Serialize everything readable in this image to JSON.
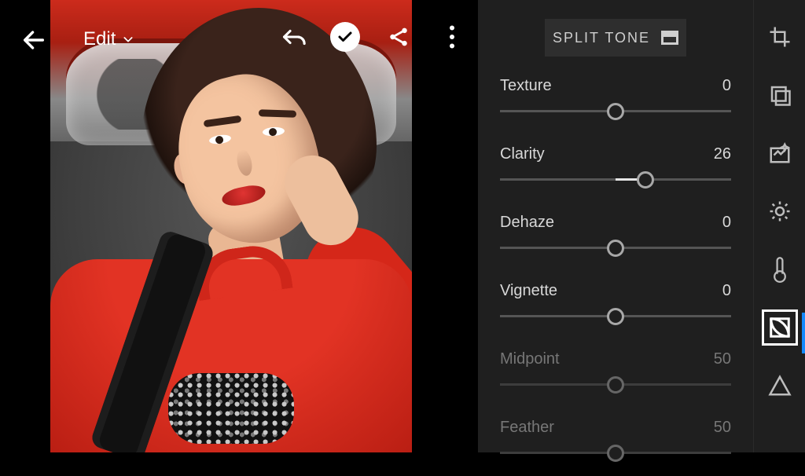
{
  "header": {
    "mode_label": "Edit"
  },
  "split_tone_button": "SPLIT TONE",
  "sliders": [
    {
      "id": "texture",
      "label": "Texture",
      "value": 0,
      "min": -100,
      "max": 100,
      "enabled": true,
      "center_zero": true
    },
    {
      "id": "clarity",
      "label": "Clarity",
      "value": 26,
      "min": -100,
      "max": 100,
      "enabled": true,
      "center_zero": true
    },
    {
      "id": "dehaze",
      "label": "Dehaze",
      "value": 0,
      "min": -100,
      "max": 100,
      "enabled": true,
      "center_zero": true
    },
    {
      "id": "vignette",
      "label": "Vignette",
      "value": 0,
      "min": -100,
      "max": 100,
      "enabled": true,
      "center_zero": true
    },
    {
      "id": "midpoint",
      "label": "Midpoint",
      "value": 50,
      "min": 0,
      "max": 100,
      "enabled": false,
      "center_zero": false
    },
    {
      "id": "feather",
      "label": "Feather",
      "value": 50,
      "min": 0,
      "max": 100,
      "enabled": false,
      "center_zero": false
    }
  ],
  "tool_rail": [
    {
      "id": "crop",
      "name": "crop-icon"
    },
    {
      "id": "presets",
      "name": "presets-icon"
    },
    {
      "id": "auto",
      "name": "auto-enhance-icon"
    },
    {
      "id": "light",
      "name": "light-icon"
    },
    {
      "id": "color",
      "name": "temperature-icon"
    },
    {
      "id": "effects",
      "name": "effects-icon"
    },
    {
      "id": "detail",
      "name": "detail-icon"
    }
  ],
  "tool_rail_selected": "effects"
}
